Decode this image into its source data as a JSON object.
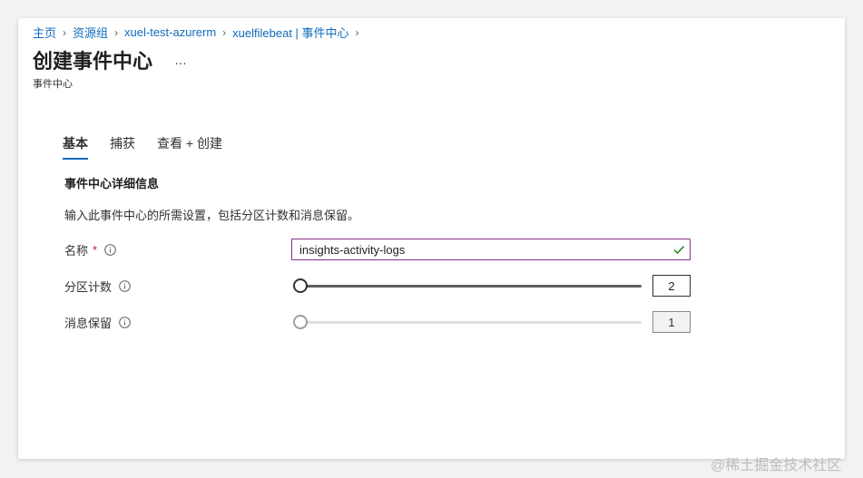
{
  "breadcrumb": {
    "items": [
      "主页",
      "资源组",
      "xuel-test-azurerm",
      "xuelfilebeat | 事件中心"
    ],
    "sep": "›"
  },
  "header": {
    "title": "创建事件中心",
    "more": "…",
    "subtitle": "事件中心"
  },
  "tabs": [
    {
      "label": "基本",
      "active": true
    },
    {
      "label": "捕获",
      "active": false
    },
    {
      "label": "查看 + 创建",
      "active": false
    }
  ],
  "section": {
    "title": "事件中心详细信息",
    "description": "输入此事件中心的所需设置，包括分区计数和消息保留。"
  },
  "form": {
    "name": {
      "label": "名称",
      "required_mark": "*",
      "value": "insights-activity-logs",
      "valid": true
    },
    "partition_count": {
      "label": "分区计数",
      "value": "2"
    },
    "message_retention": {
      "label": "消息保留",
      "value": "1",
      "disabled": true
    }
  },
  "colors": {
    "accent": "#0f6cbd",
    "input_focus_border": "#8a2f8a",
    "valid_check": "#107c10",
    "required": "#a4262c"
  },
  "watermark": "@稀土掘金技术社区"
}
